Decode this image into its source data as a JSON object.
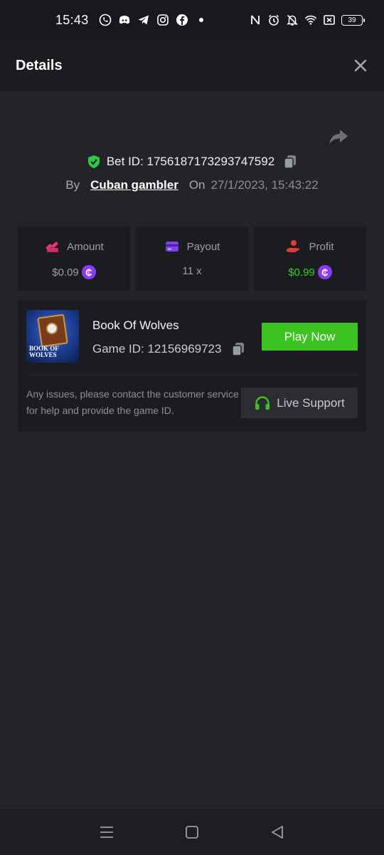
{
  "status_bar": {
    "time": "15:43",
    "battery": "39",
    "notif_icons": [
      "whatsapp-icon",
      "discord-icon",
      "telegram-icon",
      "instagram-icon",
      "facebook-icon",
      "dot-icon"
    ],
    "system_icons": [
      "nfc-icon",
      "alarm-icon",
      "mute-icon",
      "wifi-icon",
      "screen-icon",
      "battery-icon"
    ]
  },
  "header": {
    "title": "Details"
  },
  "bet": {
    "bet_id_label": "Bet ID: 1756187173293747592",
    "by_label": "By",
    "user": "Cuban gambler",
    "on_label": "On",
    "date": "27/1/2023, 15:43:22"
  },
  "stats": {
    "amount": {
      "label": "Amount",
      "value": "$0.09"
    },
    "payout": {
      "label": "Payout",
      "value": "11 x"
    },
    "profit": {
      "label": "Profit",
      "value": "$0.99"
    },
    "coin_symbol": "₵"
  },
  "game": {
    "name": "Book Of Wolves",
    "game_id_label": "Game ID: 12156969723",
    "play_label": "Play Now",
    "thumb_text_1": "BOOK OF",
    "thumb_text_2": "WOLVES",
    "notice": "Any issues, please contact the customer service for help and provide the game ID.",
    "live_support_label": "Live Support"
  },
  "colors": {
    "accent_green": "#3cc221",
    "profit_green": "#3ccb2b",
    "coin_purple": "#8d3bf2",
    "amount_pink": "#e8336e",
    "payout_purple": "#7b43e8",
    "profit_red": "#e23b3b"
  }
}
